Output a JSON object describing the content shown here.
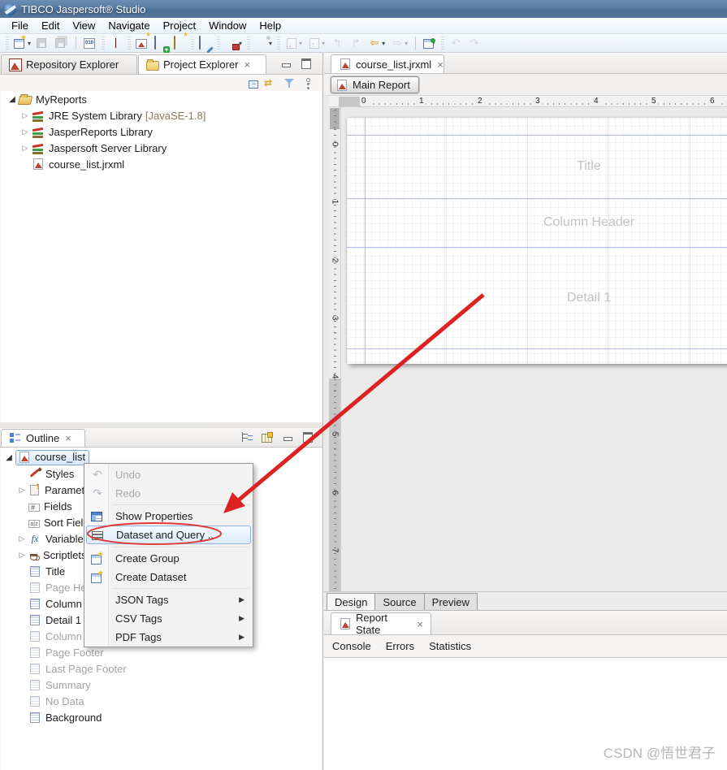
{
  "titlebar": {
    "title": "TIBCO Jaspersoft® Studio"
  },
  "menubar": {
    "items": [
      "File",
      "Edit",
      "View",
      "Navigate",
      "Project",
      "Window",
      "Help"
    ]
  },
  "toolbar": {
    "icons": [
      "new-wizard",
      "save",
      "save-all",
      "binary-file",
      "debug",
      "new-report-wizard",
      "new-datasource",
      "new-style",
      "datasource-edit",
      "run-report",
      "publish-pen",
      "import",
      "export",
      "back-disabled",
      "forward-disabled",
      "back",
      "forward",
      "pin-editor",
      "undo",
      "redo"
    ]
  },
  "ui": {
    "close_glyph": "×"
  },
  "explorer": {
    "tabs": [
      {
        "label": "Repository Explorer"
      },
      {
        "label": "Project Explorer"
      }
    ],
    "toolbar_icons": [
      "collapse-all",
      "link-with-editor",
      "filter",
      "view-menu"
    ],
    "tree": [
      {
        "label": "MyReports"
      },
      {
        "label": "JRE System Library",
        "decoration": "[JavaSE-1.8]"
      },
      {
        "label": "JasperReports Library"
      },
      {
        "label": "Jaspersoft Server Library"
      },
      {
        "label": "course_list.jrxml"
      }
    ]
  },
  "editor": {
    "tab": "course_list.jrxml",
    "main_report_button": "Main Report",
    "ruler_h": [
      "0",
      "1",
      "2",
      "3",
      "4",
      "5",
      "6"
    ],
    "ruler_v": [
      "0",
      "1",
      "2",
      "3",
      "4",
      "5",
      "6",
      "7"
    ],
    "bands": [
      "Title",
      "Column Header",
      "Detail 1"
    ],
    "bottom_tabs": [
      "Design",
      "Source",
      "Preview"
    ]
  },
  "outline": {
    "tab": "Outline",
    "toolbar_icons": [
      "expand-layout",
      "show-as-table",
      "minimize",
      "restore"
    ],
    "tree": [
      {
        "label": "course_list",
        "selected": true
      },
      {
        "label": "Styles"
      },
      {
        "label": "Parameters",
        "expandable": true
      },
      {
        "label": "Fields"
      },
      {
        "label": "Sort Fields"
      },
      {
        "label": "Variables",
        "expandable": true
      },
      {
        "label": "Scriptlets",
        "expandable": true
      },
      {
        "label": "Title",
        "band": true
      },
      {
        "label": "Page Header",
        "band": true,
        "muted": true
      },
      {
        "label": "Column Header",
        "band": true
      },
      {
        "label": "Detail 1",
        "band": true
      },
      {
        "label": "Column Footer",
        "band": true,
        "muted": true
      },
      {
        "label": "Page Footer",
        "band": true,
        "muted": true
      },
      {
        "label": "Last Page Footer",
        "band": true,
        "muted": true
      },
      {
        "label": "Summary",
        "band": true,
        "muted": true
      },
      {
        "label": "No Data",
        "band": true,
        "muted": true
      },
      {
        "label": "Background",
        "band": true
      }
    ]
  },
  "context_menu": {
    "items": [
      {
        "label": "Undo",
        "enabled": false,
        "icon": "undo-icon"
      },
      {
        "label": "Redo",
        "enabled": false,
        "icon": "redo-icon"
      },
      {
        "label": "Show Properties",
        "enabled": true,
        "icon": "properties-table-icon"
      },
      {
        "label": "Dataset and Query ...",
        "enabled": true,
        "highlighted": true,
        "icon": "dataset-query-icon"
      },
      {
        "label": "Create Group",
        "enabled": true,
        "icon": "new-wizard-icon"
      },
      {
        "label": "Create Dataset",
        "enabled": true,
        "icon": "new-wizard-icon"
      },
      {
        "label": "JSON Tags",
        "enabled": true,
        "submenu": true
      },
      {
        "label": "CSV Tags",
        "enabled": true,
        "submenu": true
      },
      {
        "label": "PDF Tags",
        "enabled": true,
        "submenu": true
      }
    ]
  },
  "report_state": {
    "tab": "Report State",
    "links": [
      "Console",
      "Errors",
      "Statistics"
    ]
  },
  "watermark": "CSDN @悟世君子",
  "colors": {
    "titlebar_blue": "#54769d",
    "selection_blue": "#d7e8f9",
    "annotation_red": "#dd2222",
    "band_guide_blue": "#b4bce4"
  }
}
